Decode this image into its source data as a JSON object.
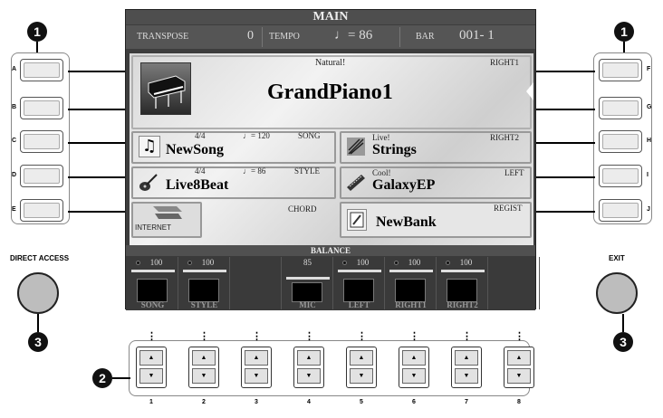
{
  "callouts": {
    "one": "1",
    "two": "2",
    "three": "3"
  },
  "left_buttons": [
    "A",
    "B",
    "C",
    "D",
    "E"
  ],
  "right_buttons": [
    "F",
    "G",
    "H",
    "I",
    "J"
  ],
  "screen": {
    "title": "MAIN",
    "transpose_label": "TRANSPOSE",
    "transpose_value": "0",
    "tempo_label": "TEMPO",
    "tempo_value": "♩= 86",
    "bar_label": "BAR",
    "bar_value": "001- 1",
    "right1": {
      "tag": "Natural!",
      "part": "RIGHT1",
      "voice": "GrandPiano1"
    },
    "right2": {
      "tag": "Live!",
      "part": "RIGHT2",
      "voice": "Strings"
    },
    "left": {
      "tag": "Cool!",
      "part": "LEFT",
      "voice": "GalaxyEP"
    },
    "song": {
      "meter": "4/4",
      "tempo": "♩= 120",
      "type": "SONG",
      "name": "NewSong"
    },
    "style": {
      "meter": "4/4",
      "tempo": "♩= 86",
      "type": "STYLE",
      "name": "Live8Beat"
    },
    "chord_label": "CHORD",
    "internet_label": "INTERNET",
    "regist": {
      "type": "REGIST",
      "name": "NewBank"
    },
    "balance_title": "BALANCE",
    "balance": [
      {
        "label": "SONG",
        "value": "100",
        "level": 100
      },
      {
        "label": "STYLE",
        "value": "100",
        "level": 100
      },
      {
        "label": "",
        "value": "",
        "level": 0
      },
      {
        "label": "MIC",
        "value": "85",
        "level": 85
      },
      {
        "label": "LEFT",
        "value": "100",
        "level": 100
      },
      {
        "label": "RIGHT1",
        "value": "100",
        "level": 100
      },
      {
        "label": "RIGHT2",
        "value": "100",
        "level": 100
      },
      {
        "label": "",
        "value": "",
        "level": 0
      }
    ]
  },
  "direct_access_label": "DIRECT ACCESS",
  "exit_label": "EXIT",
  "bottom_buttons": [
    "1",
    "2",
    "3",
    "4",
    "5",
    "6",
    "7",
    "8"
  ],
  "up_glyph": "▲",
  "down_glyph": "▼",
  "dots_glyph": "⋮"
}
